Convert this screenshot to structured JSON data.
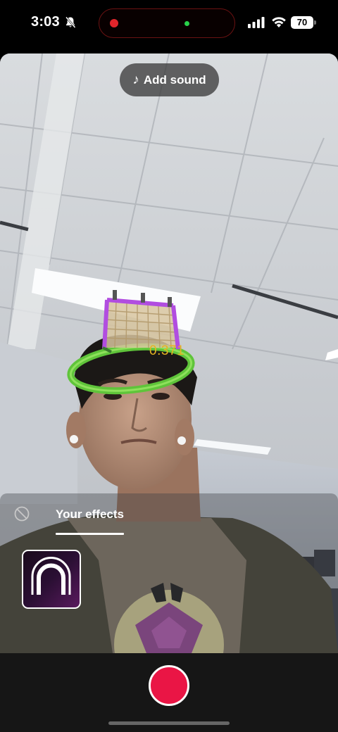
{
  "status_bar": {
    "time": "3:03",
    "battery": "70",
    "icons": [
      "bell-slash-icon",
      "signal-icon",
      "wifi-icon",
      "battery-icon"
    ]
  },
  "camera": {
    "add_sound_label": "Add sound",
    "score": "0.371"
  },
  "effects": {
    "tab_label": "Your effects",
    "thumbnail_icon": "arch-effect-icon"
  },
  "controls": {
    "record_color": "#ea1545"
  }
}
